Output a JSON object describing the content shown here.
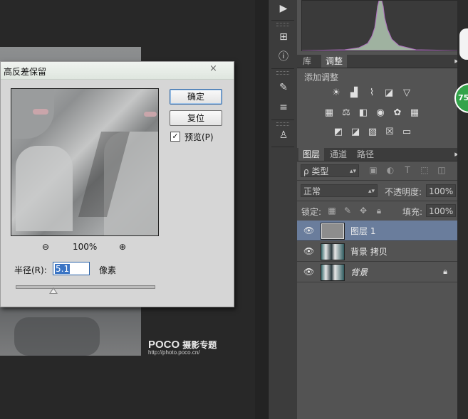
{
  "dialog": {
    "title": "高反差保留",
    "close_glyph": "×",
    "ok_label": "确定",
    "reset_label": "复位",
    "preview_checked": true,
    "preview_label": "预览(P)",
    "zoom_out_glyph": "⊖",
    "zoom_in_glyph": "⊕",
    "zoom_level": "100%",
    "radius_label": "半径(R):",
    "radius_value": "5.1",
    "radius_unit": "像素",
    "slider_fraction": 0.27
  },
  "watermark": {
    "brand": "POCO",
    "subtitle": "摄影专题",
    "url": "http://photo.poco.cn/"
  },
  "toolstrip": {
    "icons": [
      "play-icon",
      "info-icon",
      "brush-presets-icon",
      "sliders-icon",
      "clone-source-icon"
    ]
  },
  "adjustments_panel": {
    "tabs": [
      {
        "label": "库",
        "active": false
      },
      {
        "label": "调整",
        "active": true
      }
    ],
    "title": "添加调整",
    "rows": [
      [
        "brightness-icon",
        "levels-icon",
        "curves-icon",
        "exposure-icon",
        "vibrance-icon"
      ],
      [
        "hue-saturation-icon",
        "color-balance-icon",
        "black-white-icon",
        "photo-filter-icon",
        "channel-mixer-icon",
        "color-lookup-icon"
      ],
      [
        "invert-icon",
        "posterize-icon",
        "threshold-icon",
        "selective-color-icon",
        "gradient-map-icon"
      ]
    ]
  },
  "layers_panel": {
    "tabs": [
      {
        "label": "图层",
        "active": true
      },
      {
        "label": "通道",
        "active": false
      },
      {
        "label": "路径",
        "active": false
      }
    ],
    "filter_label": "ρ 类型",
    "blend_mode": "正常",
    "opacity_label": "不透明度:",
    "opacity_value": "100%",
    "lock_label": "锁定:",
    "fill_label": "填充:",
    "fill_value": "100%",
    "layers": [
      {
        "name": "图层 1",
        "selected": true,
        "visible": true,
        "locked": false,
        "italic": false
      },
      {
        "name": "背景 拷贝",
        "selected": false,
        "visible": true,
        "locked": false,
        "italic": false
      },
      {
        "name": "背景",
        "selected": false,
        "visible": true,
        "locked": true,
        "italic": true
      }
    ]
  },
  "badge": {
    "text": "75"
  }
}
